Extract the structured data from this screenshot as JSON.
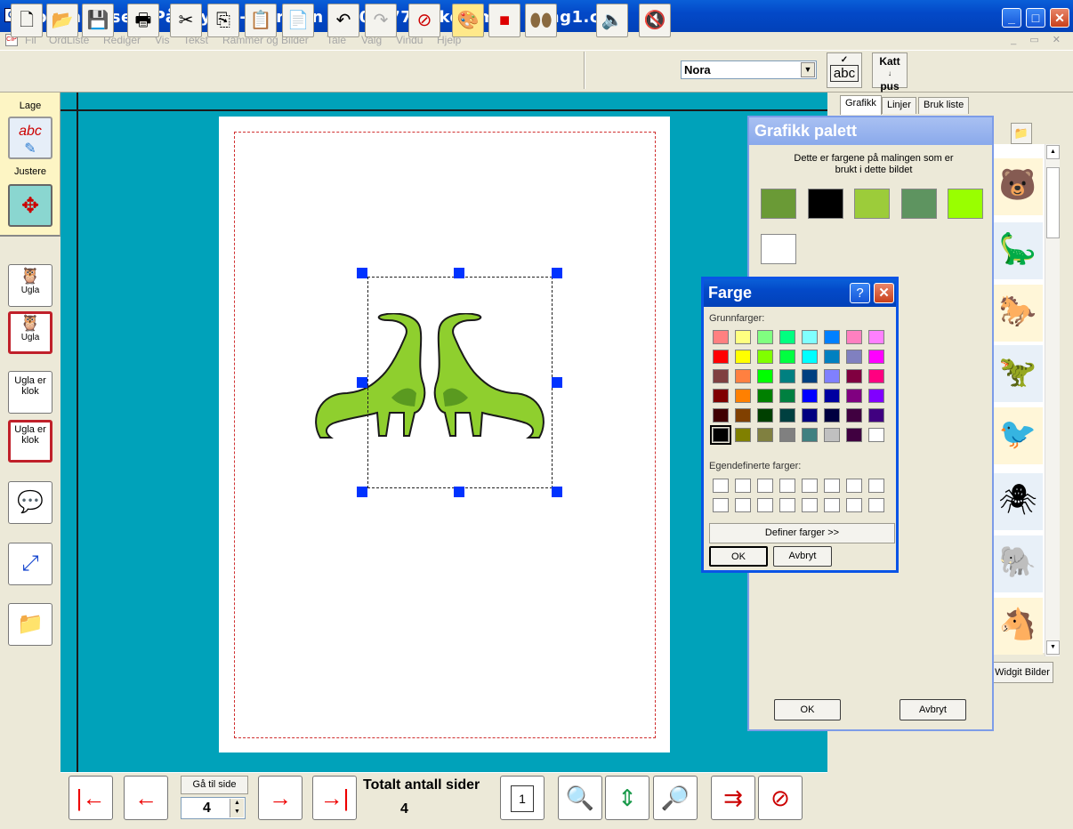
{
  "window": {
    "title": "Kommuniser: På Trykk - Versjon 2.80.377 - [komme i gang1.cip]"
  },
  "menu": [
    "Fil",
    "OrdListe",
    "Rediger",
    "Vis",
    "Tekst",
    "Rammer og Bilder",
    "Tale",
    "Valg",
    "Vindu",
    "Hjelp"
  ],
  "toolbar": {
    "voice": "Nora",
    "spell_label": "abc",
    "thesaurus_label_1": "Katt",
    "thesaurus_label_2": "pus"
  },
  "left_sidebar": {
    "create_label": "Lage",
    "adjust_label": "Justere",
    "create_icon_text": "abc",
    "symbol_word_1": "Ugla",
    "symbol_word_2": "Ugla",
    "text_1": "Ugla er klok",
    "text_2": "Ugla er klok"
  },
  "bottom_bar": {
    "goto_label": "Gå til side",
    "goto_value": "4",
    "total_pages_label": "Totalt antall sider",
    "total_pages_value": "4",
    "current_page": "1"
  },
  "right_panel": {
    "tabs": [
      "Grafikk",
      "Linjer",
      "Bruk liste"
    ],
    "widgit_button": "Widgit Bilder"
  },
  "graphics_palette": {
    "title": "Grafikk palett",
    "description": "Dette er fargene på malingen som er brukt i dette bildet",
    "swatches": [
      "#6a9a36",
      "#000000",
      "#9ccc3a",
      "#5e9460",
      "#99ff00",
      "#ffffff"
    ],
    "ok_label": "OK",
    "cancel_label": "Avbryt"
  },
  "color_dialog": {
    "title": "Farge",
    "help_label": "?",
    "basic_colors_label": "Grunnfarger:",
    "custom_colors_label": "Egendefinerte farger:",
    "define_button": "Definer farger >>",
    "ok_label": "OK",
    "cancel_label": "Avbryt",
    "basic_colors": [
      [
        "#ff8080",
        "#ffff80",
        "#80ff80",
        "#00ff80",
        "#80ffff",
        "#0080ff",
        "#ff80c0",
        "#ff80ff"
      ],
      [
        "#ff0000",
        "#ffff00",
        "#80ff00",
        "#00ff40",
        "#00ffff",
        "#0080c0",
        "#8080c0",
        "#ff00ff"
      ],
      [
        "#804040",
        "#ff8040",
        "#00ff00",
        "#008080",
        "#004080",
        "#8080ff",
        "#800040",
        "#ff0080"
      ],
      [
        "#800000",
        "#ff8000",
        "#008000",
        "#008040",
        "#0000ff",
        "#0000a0",
        "#800080",
        "#8000ff"
      ],
      [
        "#400000",
        "#804000",
        "#004000",
        "#004040",
        "#000080",
        "#000040",
        "#400040",
        "#400080"
      ],
      [
        "#000000",
        "#808000",
        "#808040",
        "#808080",
        "#408080",
        "#c0c0c0",
        "#400040",
        "#ffffff"
      ]
    ]
  }
}
